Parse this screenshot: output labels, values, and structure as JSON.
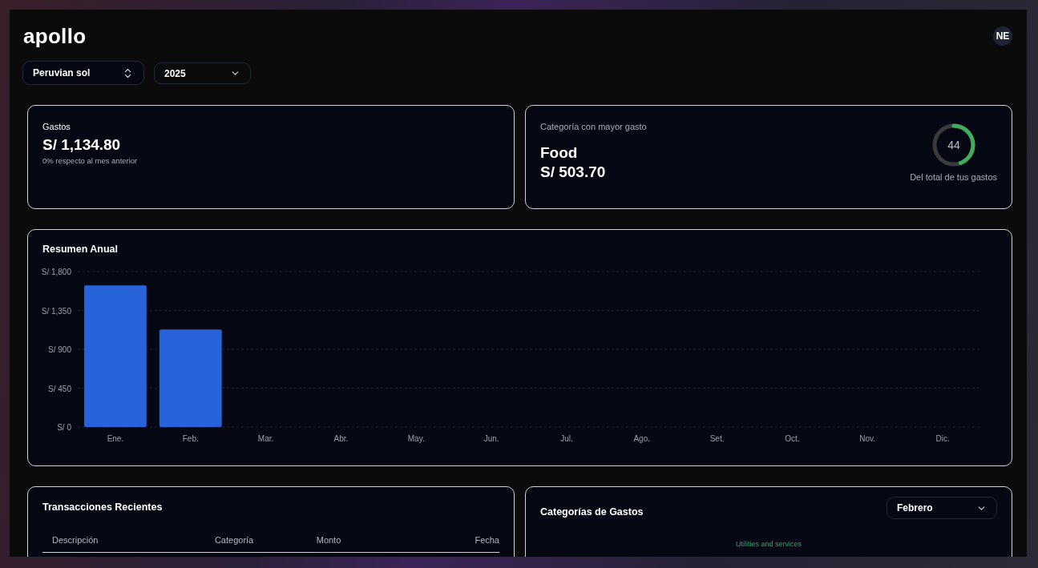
{
  "header": {
    "logo": "apollo",
    "avatar": "NE"
  },
  "filters": {
    "currency": "Peruvian sol",
    "year": "2025"
  },
  "expenses_card": {
    "title": "Gastos",
    "amount": "S/ 1,134.80",
    "comparison": "0% respecto al mes anterior"
  },
  "top_category_card": {
    "title": "Categoría con mayor gasto",
    "category": "Food",
    "amount": "S/ 503.70",
    "percent": "44",
    "level": 0.44,
    "caption": "Del total de tus gastos"
  },
  "annual_summary": {
    "title": "Resumen Anual",
    "chart_data": {
      "type": "bar",
      "categories": [
        "Ene.",
        "Feb.",
        "Mar.",
        "Abr.",
        "May.",
        "Jun.",
        "Jul.",
        "Ago.",
        "Set.",
        "Oct.",
        "Nov.",
        "Dic."
      ],
      "values": [
        1640,
        1130,
        0,
        0,
        0,
        0,
        0,
        0,
        0,
        0,
        0,
        0
      ],
      "grid": true,
      "ylim": [
        0,
        1800
      ],
      "yticks": [
        {
          "value": 0,
          "label": "S/ 0"
        },
        {
          "value": 450,
          "label": "S/ 450"
        },
        {
          "value": 900,
          "label": "S/ 900"
        },
        {
          "value": 1350,
          "label": "S/ 1,350"
        },
        {
          "value": 1800,
          "label": "S/ 1,800"
        }
      ]
    }
  },
  "recent_transactions": {
    "title": "Transacciones Recientes",
    "columns": [
      "Descripción",
      "Categoría",
      "Monto",
      "Fecha"
    ]
  },
  "expense_categories": {
    "title": "Categorías de Gastos",
    "month": "Febrero",
    "legend_label": "Utilities and services"
  }
}
